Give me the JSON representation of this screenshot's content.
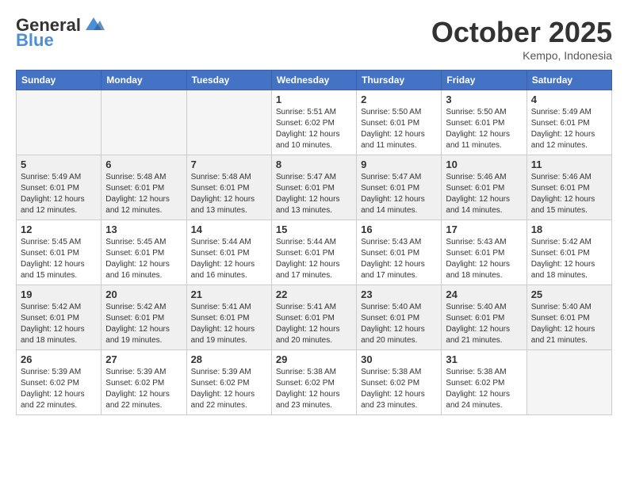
{
  "header": {
    "logo_line1": "General",
    "logo_line2": "Blue",
    "month_title": "October 2025",
    "location": "Kempo, Indonesia"
  },
  "weekdays": [
    "Sunday",
    "Monday",
    "Tuesday",
    "Wednesday",
    "Thursday",
    "Friday",
    "Saturday"
  ],
  "weeks": [
    [
      {
        "day": "",
        "empty": true
      },
      {
        "day": "",
        "empty": true
      },
      {
        "day": "",
        "empty": true
      },
      {
        "day": "1",
        "sunrise": "5:51 AM",
        "sunset": "6:02 PM",
        "daylight": "12 hours and 10 minutes."
      },
      {
        "day": "2",
        "sunrise": "5:50 AM",
        "sunset": "6:01 PM",
        "daylight": "12 hours and 11 minutes."
      },
      {
        "day": "3",
        "sunrise": "5:50 AM",
        "sunset": "6:01 PM",
        "daylight": "12 hours and 11 minutes."
      },
      {
        "day": "4",
        "sunrise": "5:49 AM",
        "sunset": "6:01 PM",
        "daylight": "12 hours and 12 minutes."
      }
    ],
    [
      {
        "day": "5",
        "sunrise": "5:49 AM",
        "sunset": "6:01 PM",
        "daylight": "12 hours and 12 minutes."
      },
      {
        "day": "6",
        "sunrise": "5:48 AM",
        "sunset": "6:01 PM",
        "daylight": "12 hours and 12 minutes."
      },
      {
        "day": "7",
        "sunrise": "5:48 AM",
        "sunset": "6:01 PM",
        "daylight": "12 hours and 13 minutes."
      },
      {
        "day": "8",
        "sunrise": "5:47 AM",
        "sunset": "6:01 PM",
        "daylight": "12 hours and 13 minutes."
      },
      {
        "day": "9",
        "sunrise": "5:47 AM",
        "sunset": "6:01 PM",
        "daylight": "12 hours and 14 minutes."
      },
      {
        "day": "10",
        "sunrise": "5:46 AM",
        "sunset": "6:01 PM",
        "daylight": "12 hours and 14 minutes."
      },
      {
        "day": "11",
        "sunrise": "5:46 AM",
        "sunset": "6:01 PM",
        "daylight": "12 hours and 15 minutes."
      }
    ],
    [
      {
        "day": "12",
        "sunrise": "5:45 AM",
        "sunset": "6:01 PM",
        "daylight": "12 hours and 15 minutes."
      },
      {
        "day": "13",
        "sunrise": "5:45 AM",
        "sunset": "6:01 PM",
        "daylight": "12 hours and 16 minutes."
      },
      {
        "day": "14",
        "sunrise": "5:44 AM",
        "sunset": "6:01 PM",
        "daylight": "12 hours and 16 minutes."
      },
      {
        "day": "15",
        "sunrise": "5:44 AM",
        "sunset": "6:01 PM",
        "daylight": "12 hours and 17 minutes."
      },
      {
        "day": "16",
        "sunrise": "5:43 AM",
        "sunset": "6:01 PM",
        "daylight": "12 hours and 17 minutes."
      },
      {
        "day": "17",
        "sunrise": "5:43 AM",
        "sunset": "6:01 PM",
        "daylight": "12 hours and 18 minutes."
      },
      {
        "day": "18",
        "sunrise": "5:42 AM",
        "sunset": "6:01 PM",
        "daylight": "12 hours and 18 minutes."
      }
    ],
    [
      {
        "day": "19",
        "sunrise": "5:42 AM",
        "sunset": "6:01 PM",
        "daylight": "12 hours and 18 minutes."
      },
      {
        "day": "20",
        "sunrise": "5:42 AM",
        "sunset": "6:01 PM",
        "daylight": "12 hours and 19 minutes."
      },
      {
        "day": "21",
        "sunrise": "5:41 AM",
        "sunset": "6:01 PM",
        "daylight": "12 hours and 19 minutes."
      },
      {
        "day": "22",
        "sunrise": "5:41 AM",
        "sunset": "6:01 PM",
        "daylight": "12 hours and 20 minutes."
      },
      {
        "day": "23",
        "sunrise": "5:40 AM",
        "sunset": "6:01 PM",
        "daylight": "12 hours and 20 minutes."
      },
      {
        "day": "24",
        "sunrise": "5:40 AM",
        "sunset": "6:01 PM",
        "daylight": "12 hours and 21 minutes."
      },
      {
        "day": "25",
        "sunrise": "5:40 AM",
        "sunset": "6:01 PM",
        "daylight": "12 hours and 21 minutes."
      }
    ],
    [
      {
        "day": "26",
        "sunrise": "5:39 AM",
        "sunset": "6:02 PM",
        "daylight": "12 hours and 22 minutes."
      },
      {
        "day": "27",
        "sunrise": "5:39 AM",
        "sunset": "6:02 PM",
        "daylight": "12 hours and 22 minutes."
      },
      {
        "day": "28",
        "sunrise": "5:39 AM",
        "sunset": "6:02 PM",
        "daylight": "12 hours and 22 minutes."
      },
      {
        "day": "29",
        "sunrise": "5:38 AM",
        "sunset": "6:02 PM",
        "daylight": "12 hours and 23 minutes."
      },
      {
        "day": "30",
        "sunrise": "5:38 AM",
        "sunset": "6:02 PM",
        "daylight": "12 hours and 23 minutes."
      },
      {
        "day": "31",
        "sunrise": "5:38 AM",
        "sunset": "6:02 PM",
        "daylight": "12 hours and 24 minutes."
      },
      {
        "day": "",
        "empty": true
      }
    ]
  ],
  "labels": {
    "sunrise": "Sunrise:",
    "sunset": "Sunset:",
    "daylight": "Daylight:"
  }
}
